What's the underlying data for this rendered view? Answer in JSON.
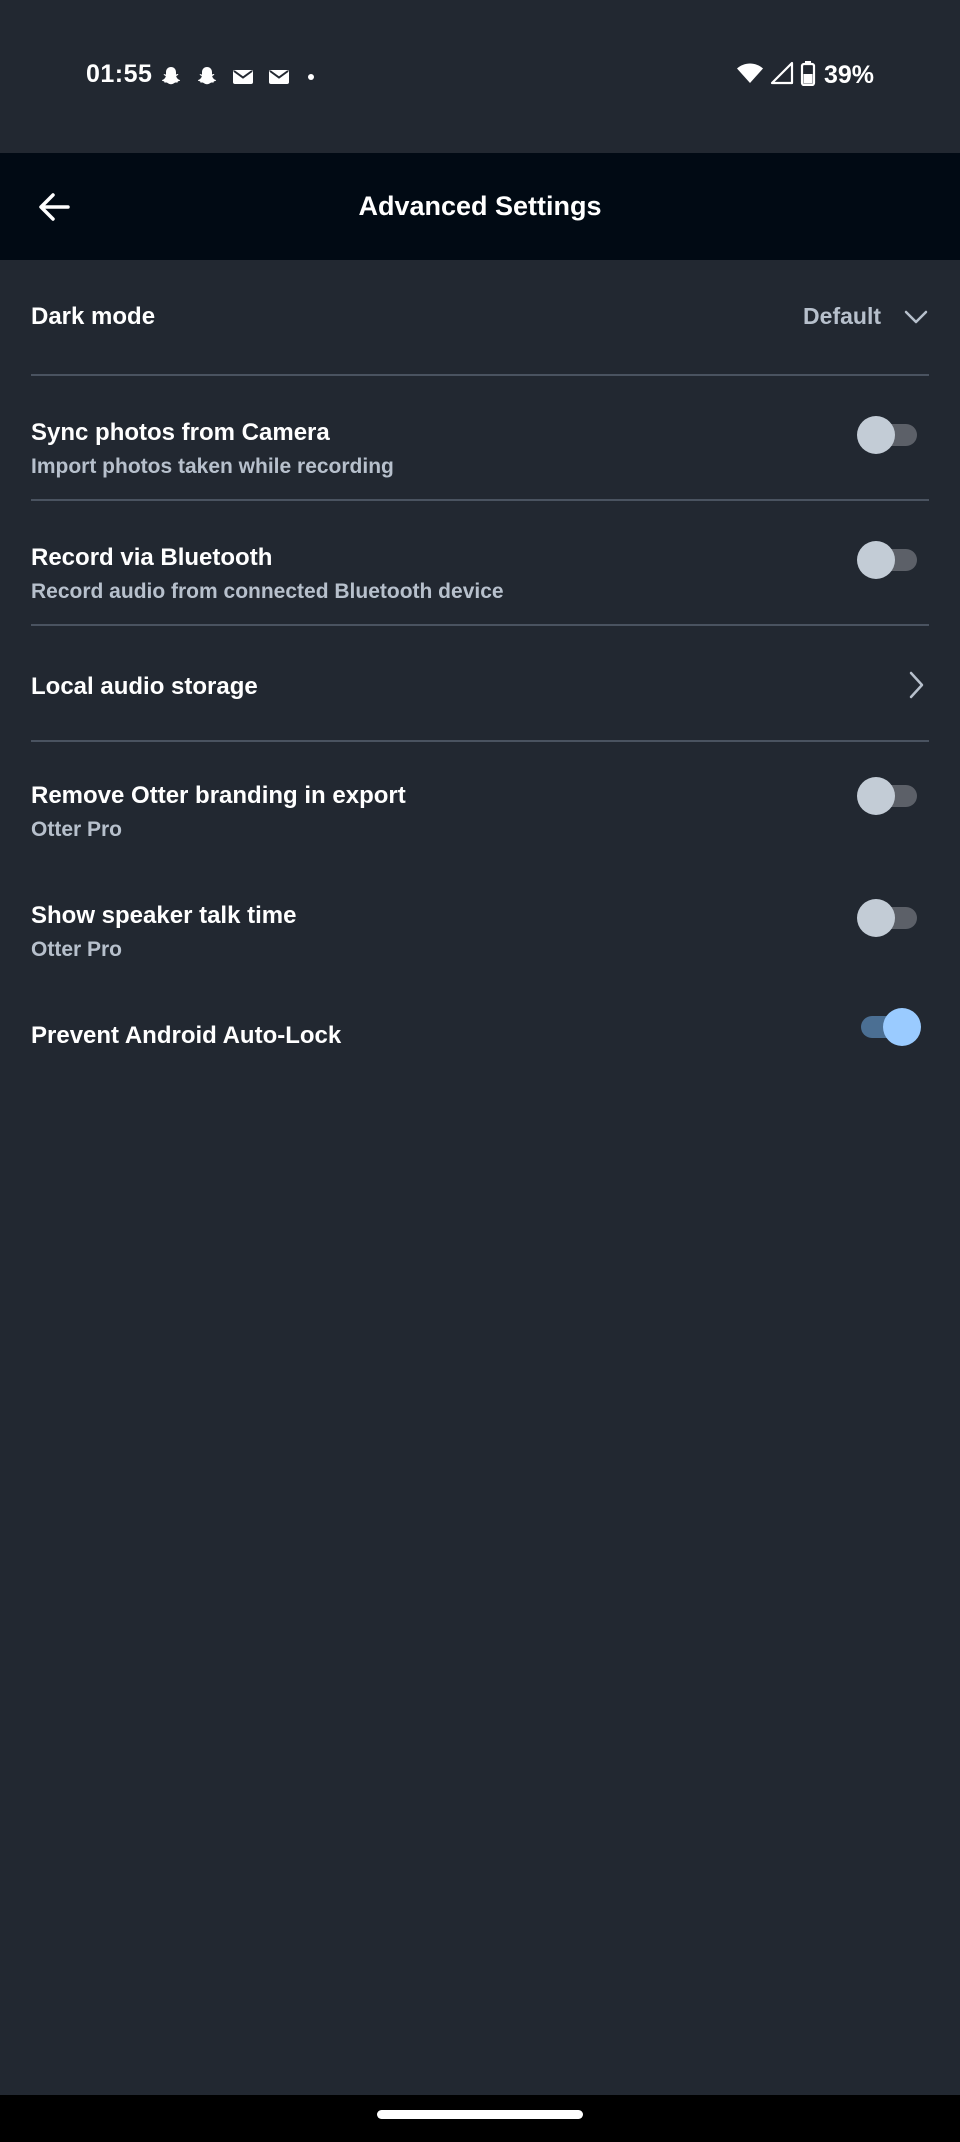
{
  "status_bar": {
    "time": "01:55",
    "notification_icons": [
      "snapchat-icon",
      "snapchat-icon",
      "gmail-icon",
      "gmail-icon",
      "dot-icon"
    ],
    "battery_percent": "39%"
  },
  "header": {
    "title": "Advanced Settings",
    "back_icon": "arrow-left-icon"
  },
  "settings": {
    "dark_mode": {
      "title": "Dark mode",
      "value": "Default"
    },
    "sync_photos": {
      "title": "Sync photos from Camera",
      "subtitle": "Import photos taken while recording",
      "enabled": false
    },
    "record_bluetooth": {
      "title": "Record via Bluetooth",
      "subtitle": "Record audio from connected Bluetooth device",
      "enabled": false
    },
    "local_audio": {
      "title": "Local audio storage"
    },
    "remove_branding": {
      "title": "Remove Otter branding in export",
      "subtitle": "Otter Pro",
      "enabled": false
    },
    "speaker_talk_time": {
      "title": "Show speaker talk time",
      "subtitle": "Otter Pro",
      "enabled": false
    },
    "prevent_autolock": {
      "title": "Prevent Android Auto-Lock",
      "enabled": true
    }
  },
  "colors": {
    "background": "#222831",
    "app_bar": "#010a14",
    "divider": "#4a5360",
    "toggle_on_thumb": "#9acbff",
    "toggle_on_track": "#4b6f93",
    "toggle_off_thumb": "#c3ccd6",
    "toggle_off_track": "#5c6068"
  }
}
